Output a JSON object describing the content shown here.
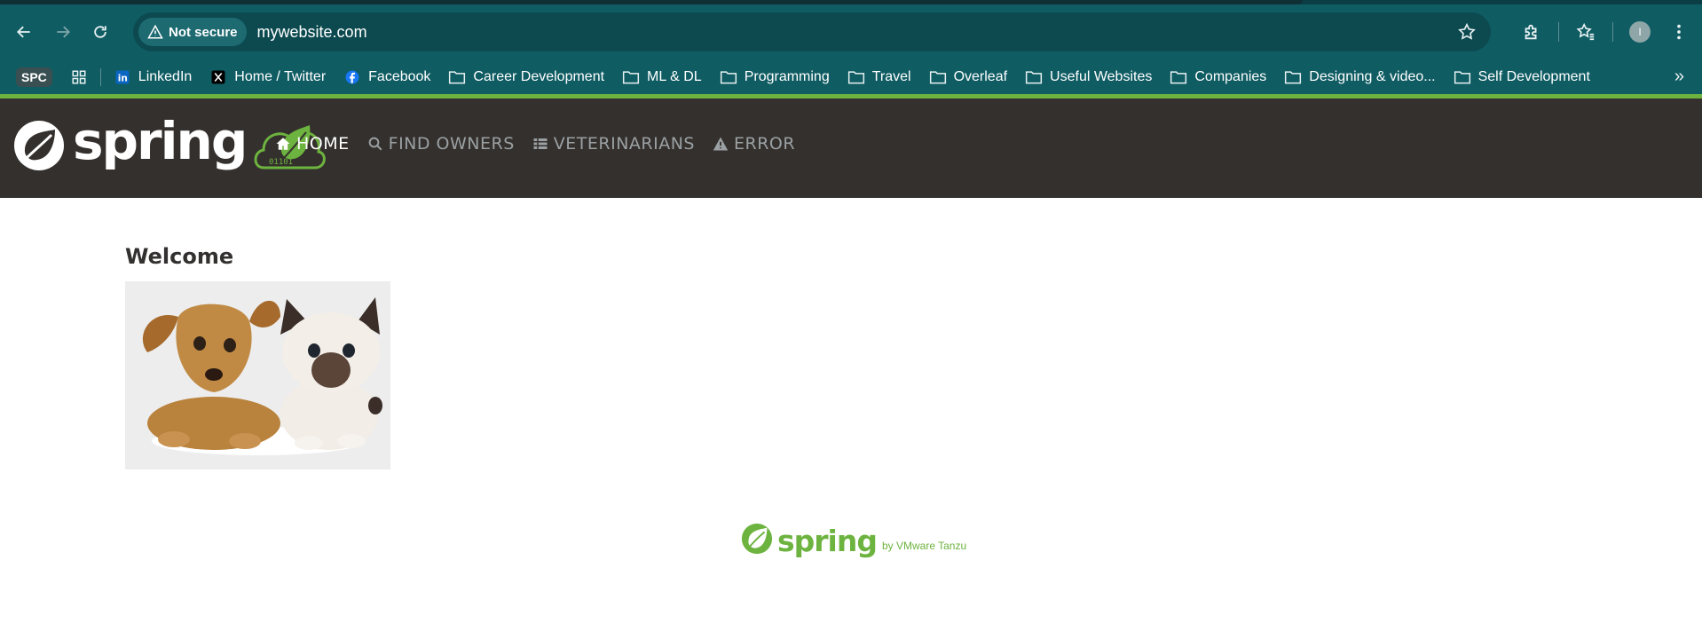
{
  "browser": {
    "security_label": "Not secure",
    "url": "mywebsite.com",
    "profile_initial": "I",
    "bookmarks": [
      {
        "label": "SPC"
      },
      {
        "label": "LinkedIn"
      },
      {
        "label": "Home / Twitter"
      },
      {
        "label": "Facebook"
      },
      {
        "label": "Career Development"
      },
      {
        "label": "ML & DL"
      },
      {
        "label": "Programming"
      },
      {
        "label": "Travel"
      },
      {
        "label": "Overleaf"
      },
      {
        "label": "Useful Websites"
      },
      {
        "label": "Companies"
      },
      {
        "label": "Designing & video..."
      },
      {
        "label": "Self Development"
      }
    ]
  },
  "site": {
    "brand": "spring",
    "nav": {
      "home": "HOME",
      "find_owners": "FIND OWNERS",
      "veterinarians": "VETERINARIANS",
      "error": "ERROR"
    },
    "welcome": "Welcome",
    "footer": {
      "brand": "spring",
      "tagline": "by VMware Tanzu"
    }
  },
  "colors": {
    "accent": "#6db33f",
    "navbar": "#34302d",
    "chrome": "#0f5c63"
  }
}
